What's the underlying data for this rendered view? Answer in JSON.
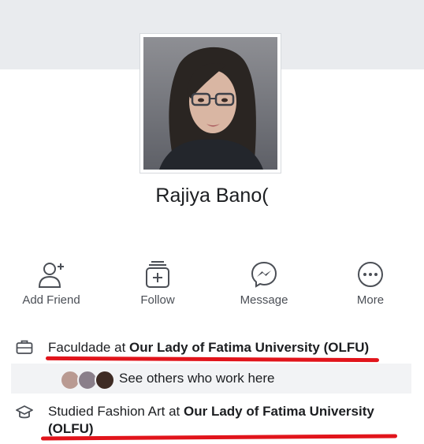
{
  "profile": {
    "name": "Rajiya Bano("
  },
  "actions": [
    {
      "label": "Add Friend",
      "icon": "add-friend-icon"
    },
    {
      "label": "Follow",
      "icon": "follow-icon"
    },
    {
      "label": "Message",
      "icon": "messenger-icon"
    },
    {
      "label": "More",
      "icon": "more-icon"
    }
  ],
  "work": {
    "prefix": "Faculdade at ",
    "place": "Our Lady of Fatima University (OLFU)",
    "icon": "briefcase-icon"
  },
  "coworkers": {
    "label": "See others who work here"
  },
  "education": {
    "prefix": "Studied Fashion Art at ",
    "place_line1": "Our Lady of Fatima University",
    "place_line2": "(OLFU)",
    "icon": "graduation-cap-icon"
  },
  "colors": {
    "cover": "#e9ebee",
    "icon_stroke": "#4b4f56",
    "highlight_underline": "#e1141b",
    "coworker_strip": "#f2f3f5"
  }
}
